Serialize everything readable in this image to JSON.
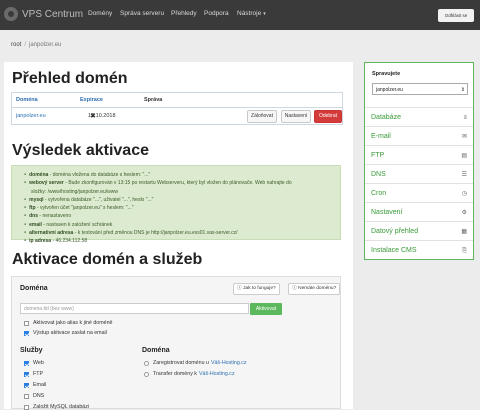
{
  "nav": {
    "brand": "VPS Centrum",
    "items": [
      "Domény",
      "Správa serveru",
      "Přehledy",
      "Podpora",
      "Nástroje"
    ],
    "logout": "Odhlásit se"
  },
  "breadcrumb": {
    "root": "root",
    "current": "janpolzer.eu"
  },
  "overview": {
    "title": "Přehled domén",
    "headers": {
      "domain": "Doména",
      "expiry": "Expirace",
      "manage": "Správa"
    },
    "row": {
      "domain": "janpolzer.eu",
      "expiry": "19.10.2018",
      "btn_manage": "Záloňovat",
      "btn_settings": "Nastavení",
      "btn_delete": "Odebrat"
    }
  },
  "result": {
    "title": "Výsledek aktivace",
    "lines": [
      {
        "b": "doména",
        "t": " - doména vložena do databáze s heslem: \"...\""
      },
      {
        "b": "webový server",
        "t": " - Bude zkonfigurován v 13:15 po restartu Webserveru, který byl vložen do plánovače. Web nahrajte do"
      },
      {
        "b": "",
        "t": "složky: /www/hosting/janpolzer.eu/www"
      },
      {
        "b": "mysql",
        "t": " - vytvořena databáze \"...\", uživatel \"...\", heslo \"...\""
      },
      {
        "b": "ftp",
        "t": " - vytvořen účet \"janpolzer.eu\" s heslem: \"...\""
      },
      {
        "b": "dns",
        "t": " - nenastaveno"
      },
      {
        "b": "email",
        "t": " - nastaven k založení schránek"
      },
      {
        "b": "alternativní adresa",
        "t": " - k testování před změnou DNS je http://janpolzer.eu.ess01.vas-server.cz/"
      },
      {
        "b": "ip adresa",
        "t": " - 46.234.112.58"
      }
    ]
  },
  "activation": {
    "title": "Aktivace domén a služeb",
    "domain_label": "Doména",
    "help1": "Jak to funguje?",
    "help2": "Nemáte doménu?",
    "input_placeholder": "domena.tld (bez www)",
    "activate": "Aktivovat",
    "alias": "Aktivovat jako alias k jiné doméně",
    "email_result": "Výstup aktivace zaslat na email",
    "services_label": "Služby",
    "services": [
      "Web",
      "FTP",
      "Email",
      "DNS",
      "Založit MySQL databázi"
    ],
    "services_checked": [
      true,
      true,
      true,
      false,
      false
    ],
    "domain_section": "Doména",
    "register_text": "Zaregistrovat doménu u",
    "transfer_text": "Transfer domény k",
    "provider": "Váš-Hosting.cz"
  },
  "sidebar": {
    "title": "Spravujete",
    "selected": "janpolzer.eu",
    "items": [
      {
        "label": "Databáze",
        "icon": "≡"
      },
      {
        "label": "E-mail",
        "icon": "✉"
      },
      {
        "label": "FTP",
        "icon": "▤"
      },
      {
        "label": "DNS",
        "icon": "☰"
      },
      {
        "label": "Cron",
        "icon": "◷"
      },
      {
        "label": "Nastavení",
        "icon": "⚙"
      },
      {
        "label": "Datový přehled",
        "icon": "▦"
      },
      {
        "label": "Instalace CMS",
        "icon": "⎘"
      }
    ]
  }
}
